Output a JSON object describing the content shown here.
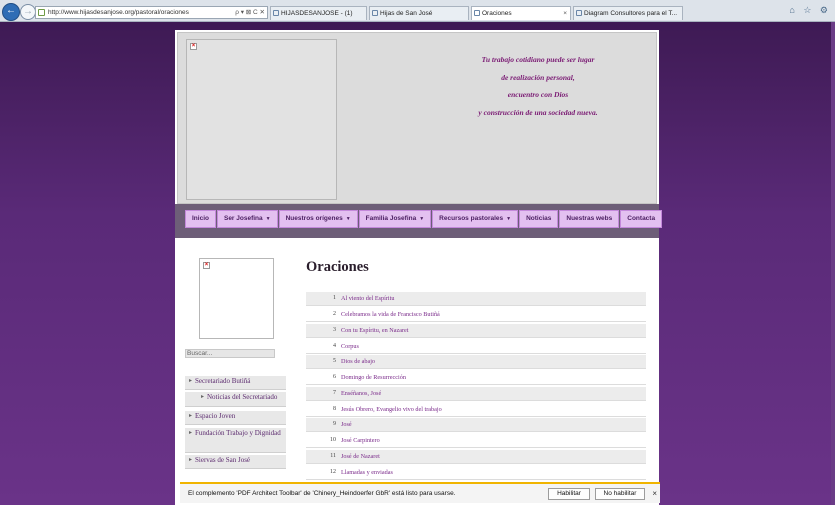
{
  "browser": {
    "url": "http://www.hijasdesanjose.org/pastoral/oraciones",
    "addr_tools": "ρ ▾ ⊠ C ✕",
    "tabs": [
      {
        "label": "HIJASDESANJOSE - (1)",
        "active": false
      },
      {
        "label": "Hijas de San José",
        "active": false
      },
      {
        "label": "Oraciones",
        "active": true
      },
      {
        "label": "Diagram Consultores para el T...",
        "active": false
      }
    ],
    "back_icon": "back-arrow-icon",
    "forward_icon": "forward-arrow-icon",
    "right_icons": "⌂ ☆ ⚙"
  },
  "header": {
    "slogan": [
      "Tu trabajo cotidiano puede ser lugar",
      "de realización personal,",
      "encuentro con Dios",
      "y construcción de una sociedad nueva."
    ]
  },
  "menu": [
    {
      "label": "Inicio",
      "dropdown": false
    },
    {
      "label": "Ser Josefina",
      "dropdown": true
    },
    {
      "label": "Nuestros orígenes",
      "dropdown": true
    },
    {
      "label": "Familia Josefina",
      "dropdown": true
    },
    {
      "label": "Recursos pastorales",
      "dropdown": true
    },
    {
      "label": "Noticias",
      "dropdown": false
    },
    {
      "label": "Nuestras webs",
      "dropdown": false
    },
    {
      "label": "Contacta",
      "dropdown": false
    }
  ],
  "sidebar": {
    "search_placeholder": "Buscar...",
    "items": [
      {
        "label": "Secretariado Butiñá"
      },
      {
        "label": "Noticias del Secretariado"
      },
      {
        "label": "Espacio Joven"
      },
      {
        "label": "Fundación Trabajo y Dignidad"
      },
      {
        "label": "Siervas de San José"
      }
    ]
  },
  "content": {
    "title": "Oraciones",
    "prayers": [
      {
        "num": "1",
        "title": "Al viento del Espíritu"
      },
      {
        "num": "2",
        "title": "Celebramos la vida de Francisco Butiñá"
      },
      {
        "num": "3",
        "title": "Con tu Espíritu, en Nazaret"
      },
      {
        "num": "4",
        "title": "Corpus"
      },
      {
        "num": "5",
        "title": "Dios de abajo"
      },
      {
        "num": "6",
        "title": "Domingo de Resurrección"
      },
      {
        "num": "7",
        "title": "Enséñanos, José"
      },
      {
        "num": "8",
        "title": "Jesús Obrero, Evangelio vivo del trabajo"
      },
      {
        "num": "9",
        "title": "José"
      },
      {
        "num": "10",
        "title": "José Carpintero"
      },
      {
        "num": "11",
        "title": "José de Nazaret"
      },
      {
        "num": "12",
        "title": "Llamadas y enviadas"
      }
    ]
  },
  "notification": {
    "text": "El complemento 'PDF Architect Toolbar' de 'Chinery_Heindoerfer GbR' está listo para usarse.",
    "enable_label": "Habilitar",
    "disable_label": "No habilitar",
    "close_glyph": "×"
  },
  "colors": {
    "accent_purple": "#7a1a73",
    "menu_bg": "#e3c0f0",
    "notification_border": "#f0b400"
  }
}
